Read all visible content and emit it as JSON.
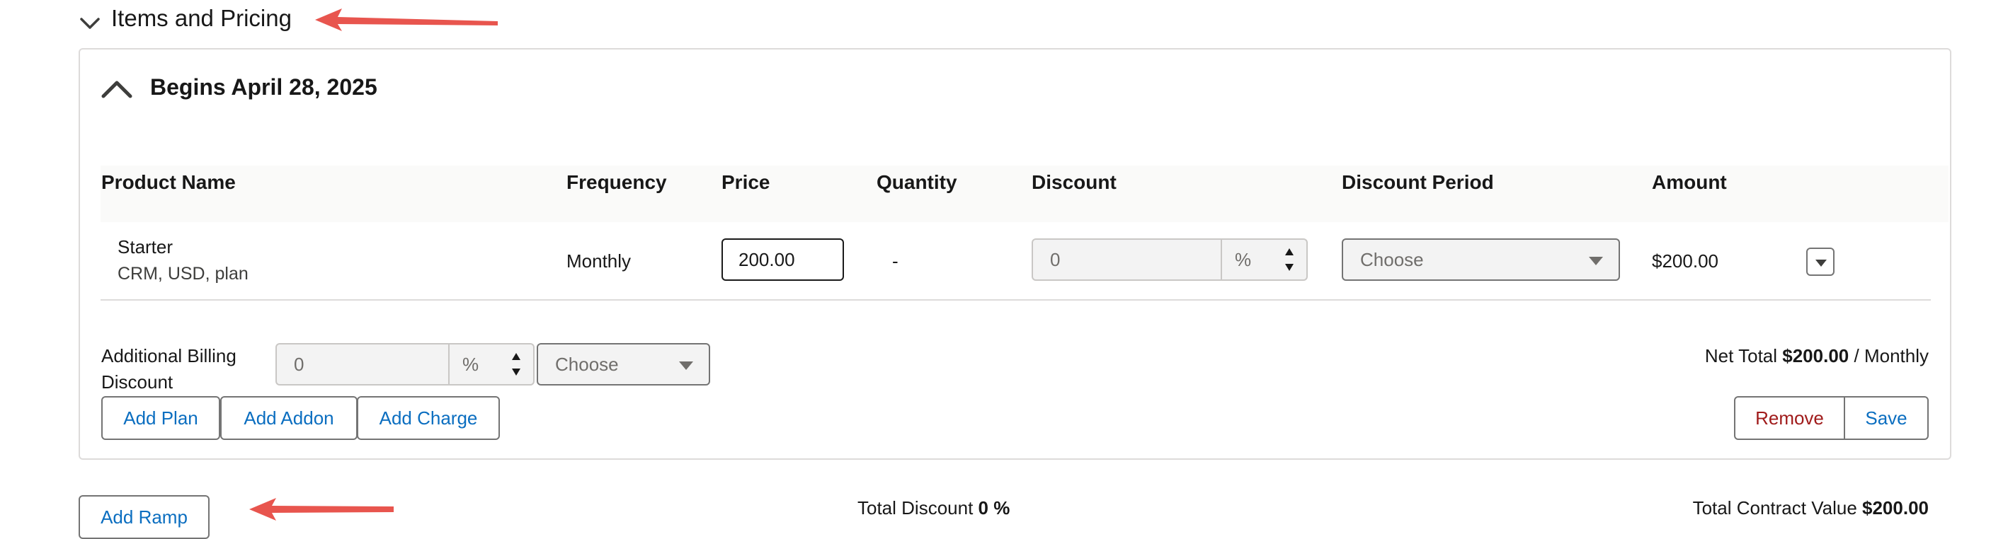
{
  "section": {
    "title": "Items and Pricing"
  },
  "ramp": {
    "title": "Begins April 28, 2025"
  },
  "table": {
    "headers": [
      "Product Name",
      "Frequency",
      "Price",
      "Quantity",
      "Discount",
      "Discount Period",
      "Amount"
    ],
    "rows": [
      {
        "product": "Starter",
        "product_detail": "CRM, USD, plan",
        "frequency": "Monthly",
        "price": "200.00",
        "quantity": "-",
        "discount_value": "0",
        "discount_unit": "%",
        "discount_period": "Choose",
        "amount": "$200.00"
      }
    ]
  },
  "additional_billing": {
    "label_line1": "Additional Billing",
    "label_line2": "Discount",
    "value": "0",
    "unit": "%",
    "period": "Choose"
  },
  "net_total": {
    "label": "Net Total",
    "value": "$200.00",
    "separator": "/",
    "period": "Monthly"
  },
  "buttons": {
    "add_plan": "Add Plan",
    "add_addon": "Add Addon",
    "add_charge": "Add Charge",
    "remove": "Remove",
    "save": "Save",
    "add_ramp": "Add Ramp"
  },
  "totals": {
    "discount_label": "Total Discount",
    "discount_value": "0 %",
    "contract_label": "Total Contract Value",
    "contract_value": "$200.00"
  },
  "colors": {
    "link_blue": "#0b6ec0",
    "remove_red": "#a01b1b",
    "annotation_arrow": "#e8554e",
    "border": "#dddbda"
  }
}
